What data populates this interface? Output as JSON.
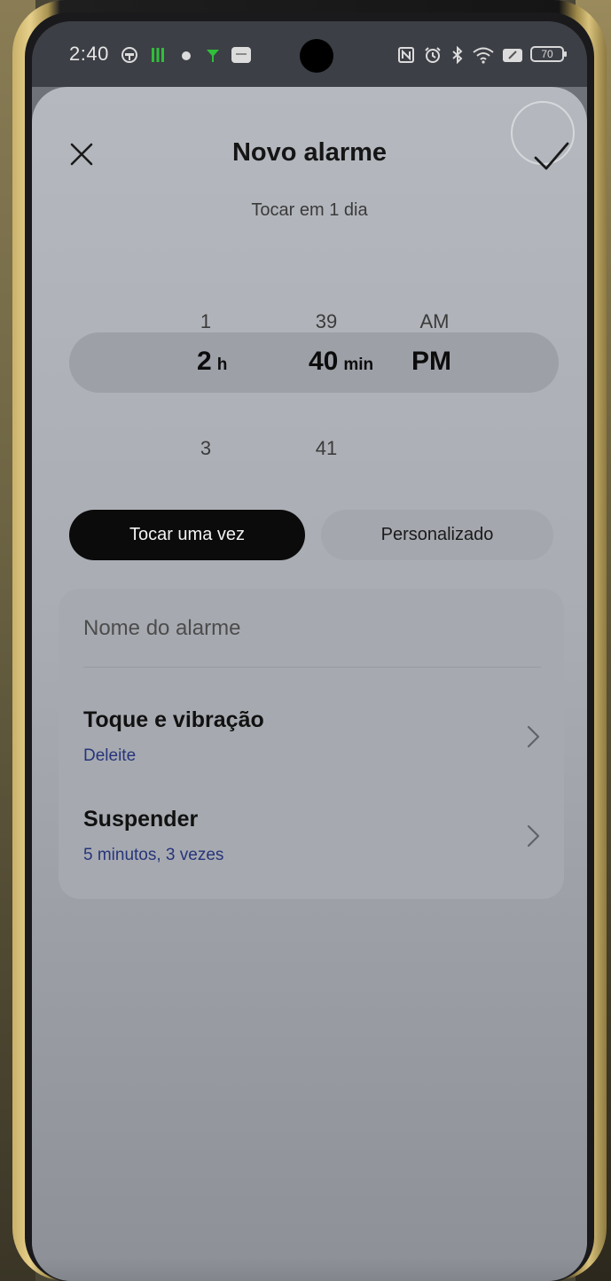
{
  "status_bar": {
    "time": "2:40",
    "battery": "70",
    "left_icons": [
      "ghost-icon",
      "grid-app-icon",
      "notification-dot-icon",
      "signal-app-icon",
      "message-icon"
    ],
    "right_icons": [
      "nfc-icon",
      "alarm-clock-icon",
      "bluetooth-icon",
      "wifi-icon",
      "data-saver-icon"
    ]
  },
  "header": {
    "title": "Novo alarme",
    "subtitle": "Tocar em 1 dia",
    "close_icon": "close-icon",
    "confirm_icon": "check-icon"
  },
  "time_picker": {
    "hours": {
      "above": "1",
      "selected": "2",
      "below": "3",
      "unit": "h"
    },
    "minutes": {
      "above": "39",
      "selected": "40",
      "below": "41",
      "unit": "min"
    },
    "period": {
      "above": "AM",
      "selected": "PM"
    }
  },
  "repeat": {
    "options": [
      "Tocar uma vez",
      "Personalizado"
    ],
    "selected": "Tocar uma vez"
  },
  "settings": {
    "name_placeholder": "Nome do alarme",
    "sound": {
      "label": "Toque e vibração",
      "value": "Deleite"
    },
    "snooze": {
      "label": "Suspender",
      "value": "5 minutos, 3 vezes"
    }
  },
  "colors": {
    "accent_text": "#27347a",
    "selected_segment": "#0b0b0b"
  }
}
